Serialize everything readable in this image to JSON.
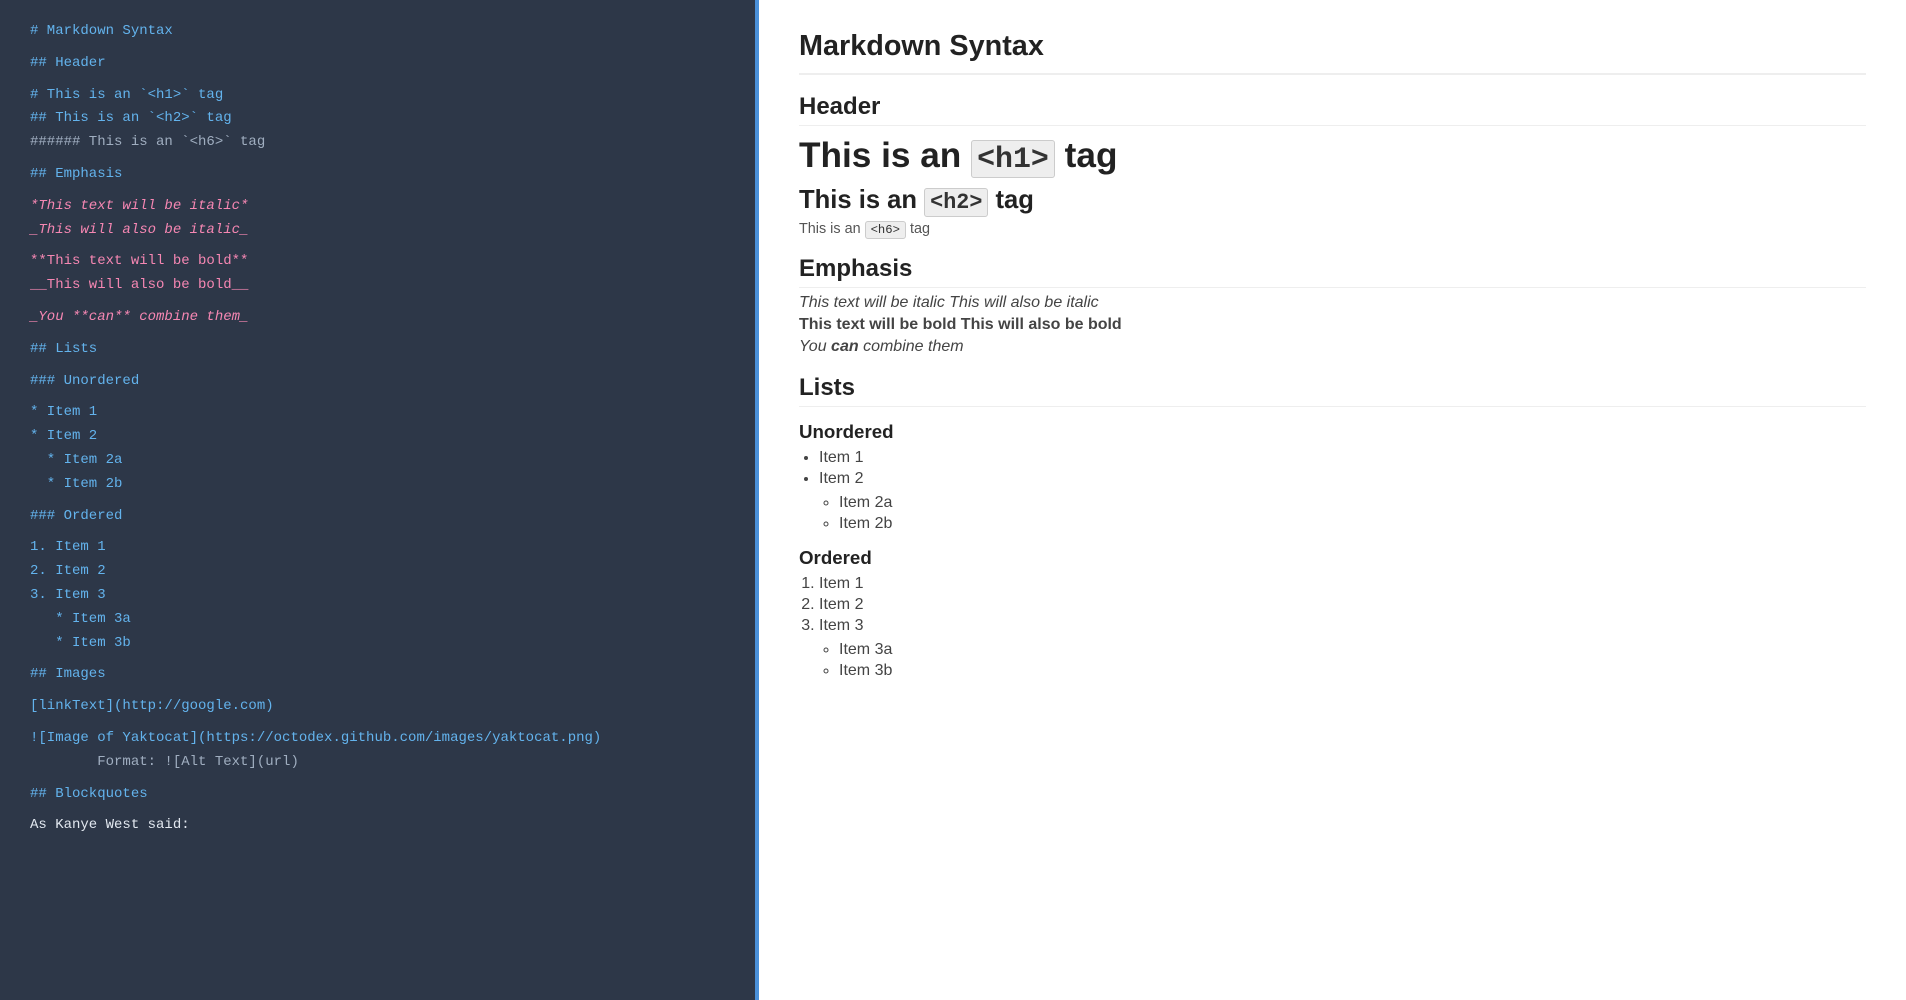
{
  "editor": {
    "lines": [
      {
        "text": "# Markdown Syntax",
        "class": "c-heading"
      },
      {
        "text": "",
        "class": "spacer"
      },
      {
        "text": "## Header",
        "class": "c-heading"
      },
      {
        "text": "",
        "class": "spacer"
      },
      {
        "text": "# This is an `<h1>` tag",
        "class": "c-heading"
      },
      {
        "text": "## This is an `<h2>` tag",
        "class": "c-heading"
      },
      {
        "text": "###### This is an `<h6>` tag",
        "class": "c-gray"
      },
      {
        "text": "",
        "class": "spacer"
      },
      {
        "text": "## Emphasis",
        "class": "c-heading"
      },
      {
        "text": "",
        "class": "spacer"
      },
      {
        "text": "*This text will be italic*",
        "class": "c-italic"
      },
      {
        "text": "_This will also be italic_",
        "class": "c-italic"
      },
      {
        "text": "",
        "class": "spacer"
      },
      {
        "text": "**This text will be bold**",
        "class": "c-bold"
      },
      {
        "text": "__This will also be bold__",
        "class": "c-bold"
      },
      {
        "text": "",
        "class": "spacer"
      },
      {
        "text": "_You **can** combine them_",
        "class": "c-italic"
      },
      {
        "text": "",
        "class": "spacer"
      },
      {
        "text": "## Lists",
        "class": "c-heading"
      },
      {
        "text": "",
        "class": "spacer"
      },
      {
        "text": "### Unordered",
        "class": "c-heading"
      },
      {
        "text": "",
        "class": "spacer"
      },
      {
        "text": "* Item 1",
        "class": "c-bullet"
      },
      {
        "text": "* Item 2",
        "class": "c-bullet"
      },
      {
        "text": "  * Item 2a",
        "class": "c-bullet"
      },
      {
        "text": "  * Item 2b",
        "class": "c-bullet"
      },
      {
        "text": "",
        "class": "spacer"
      },
      {
        "text": "### Ordered",
        "class": "c-heading"
      },
      {
        "text": "",
        "class": "spacer"
      },
      {
        "text": "1. Item 1",
        "class": "c-num"
      },
      {
        "text": "2. Item 2",
        "class": "c-num"
      },
      {
        "text": "3. Item 3",
        "class": "c-num"
      },
      {
        "text": "   * Item 3a",
        "class": "c-bullet"
      },
      {
        "text": "   * Item 3b",
        "class": "c-bullet"
      },
      {
        "text": "",
        "class": "spacer"
      },
      {
        "text": "## Images",
        "class": "c-heading"
      },
      {
        "text": "",
        "class": "spacer"
      },
      {
        "text": "[linkText](http://google.com)",
        "class": "c-link"
      },
      {
        "text": "",
        "class": "spacer"
      },
      {
        "text": "![Image of Yaktocat](https://octodex.github.com/images/yaktocat.png)",
        "class": "c-image"
      },
      {
        "text": "        Format: ![Alt Text](url)",
        "class": "c-gray"
      },
      {
        "text": "",
        "class": "spacer"
      },
      {
        "text": "## Blockquotes",
        "class": "c-heading"
      },
      {
        "text": "",
        "class": "spacer"
      },
      {
        "text": "As Kanye West said:",
        "class": "c-white"
      }
    ]
  },
  "preview": {
    "main_title": "Markdown Syntax",
    "header_section": "Header",
    "h1_prefix": "This is an",
    "h1_code": "<h1>",
    "h1_suffix": "tag",
    "h2_prefix": "This is an",
    "h2_code": "<h2>",
    "h2_suffix": "tag",
    "h6_prefix": "This is an",
    "h6_code": "<h6>",
    "h6_suffix": "tag",
    "emphasis_section": "Emphasis",
    "italic_text1": "This text will be italic",
    "italic_text2": "This will also be italic",
    "bold_text1": "This text will be bold",
    "bold_text2": "This will also be bold",
    "combine_text_before": "You",
    "combine_text_can": "can",
    "combine_text_after": "combine them",
    "lists_section": "Lists",
    "unordered_section": "Unordered",
    "unordered_items": [
      "Item 1",
      "Item 2"
    ],
    "unordered_subitems": [
      "Item 2a",
      "Item 2b"
    ],
    "ordered_section": "Ordered",
    "ordered_items": [
      "Item 1",
      "Item 2",
      "Item 3"
    ],
    "ordered_subitems": [
      "Item 3a",
      "Item 3b"
    ]
  }
}
